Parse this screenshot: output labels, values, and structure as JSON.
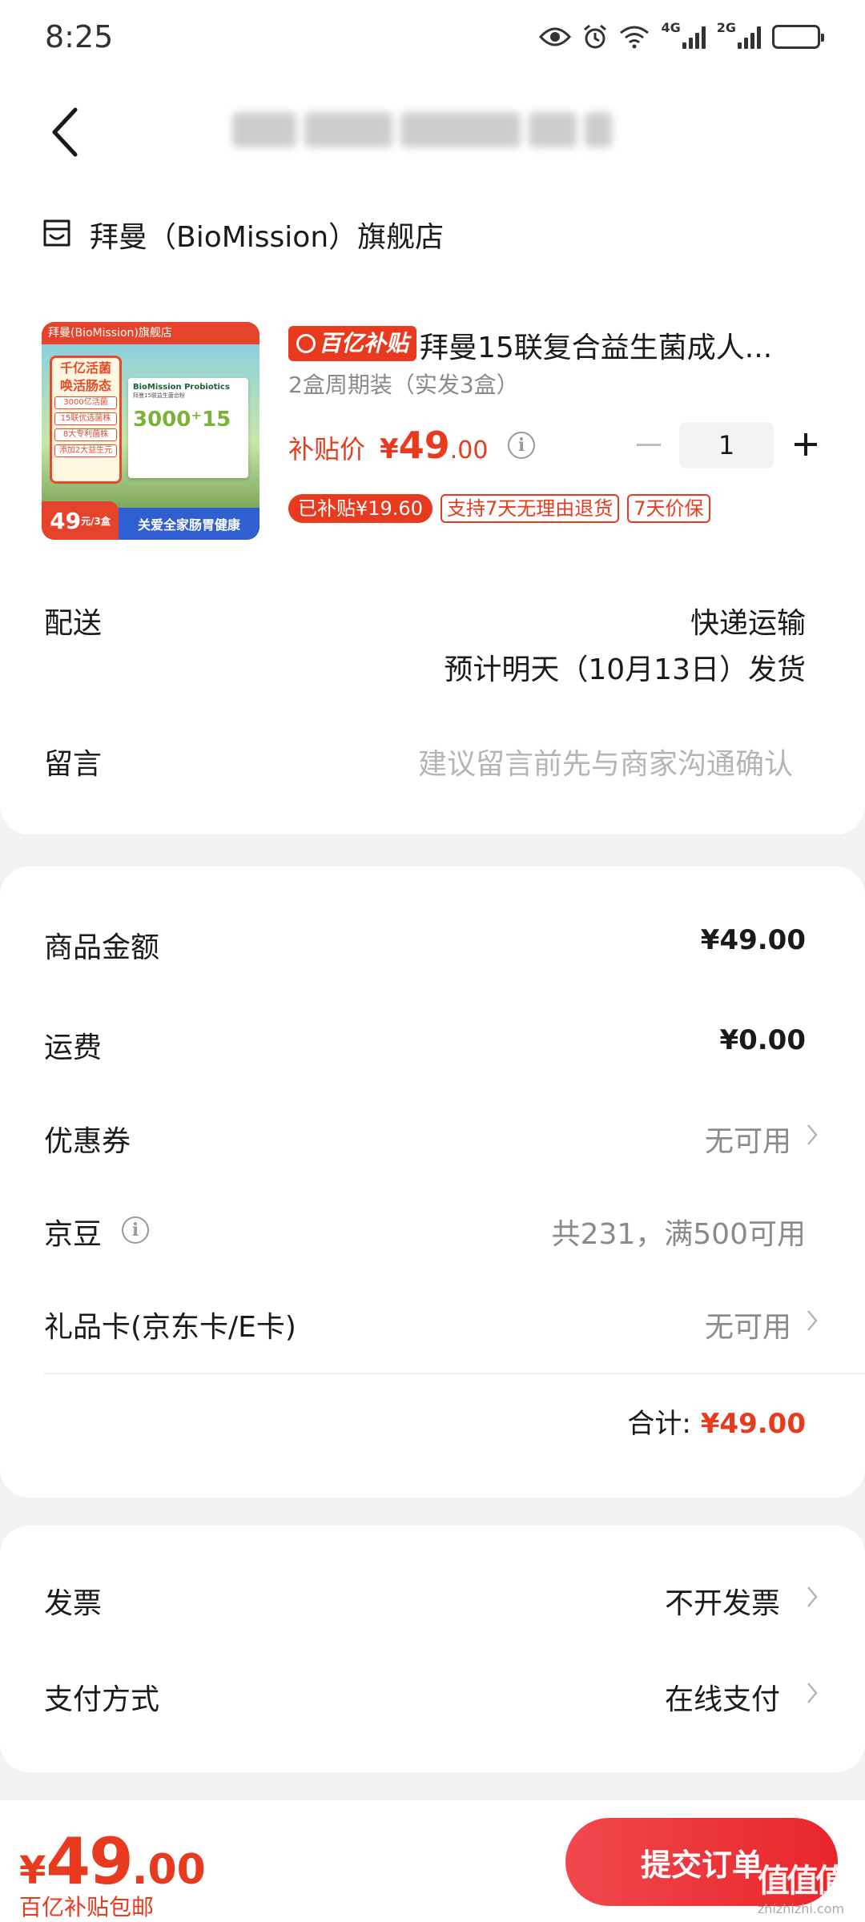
{
  "status_bar": {
    "time": "8:25",
    "network_1": "4G",
    "network_2": "2G"
  },
  "header": {
    "back_icon": "chevron-left-icon"
  },
  "shop": {
    "icon": "store-icon",
    "name": "拜曼（BioMission）旗舰店"
  },
  "product": {
    "image": {
      "top_banner": "拜曼(BioMission)旗舰店",
      "headline_1": "千亿活菌",
      "headline_2": "唤活肠态",
      "labels": [
        "3000亿活菌",
        "15联优选菌株",
        "8大专利菌株",
        "添加2大益生元"
      ],
      "box_brand": "BioMission Probiotics",
      "box_sub": "拜曼15联益生菌合粉",
      "box_number": "3000⁺15",
      "price_int": "49",
      "price_unit": "元/3盒",
      "slogan": "关爱全家肠胃健康"
    },
    "subsidy_badge": "百亿补贴",
    "title": "拜曼15联复合益生菌成人...",
    "spec": "2盒周期装（实发3盒）",
    "price_label": "补贴价",
    "price_currency": "¥",
    "price_int": "49",
    "price_dec": ".00",
    "quantity": "1",
    "tags": [
      "已补贴¥19.60",
      "支持7天无理由退货",
      "7天价保"
    ]
  },
  "delivery": {
    "label": "配送",
    "method": "快递运输",
    "eta": "预计明天（10月13日）发货"
  },
  "message": {
    "label": "留言",
    "placeholder": "建议留言前先与商家沟通确认"
  },
  "summary": {
    "goods_label": "商品金额",
    "goods_value": "¥49.00",
    "shipping_label": "运费",
    "shipping_value": "¥0.00",
    "coupon_label": "优惠券",
    "coupon_value": "无可用",
    "beans_label": "京豆",
    "beans_value": "共231，满500可用",
    "giftcard_label": "礼品卡(京东卡/E卡)",
    "giftcard_value": "无可用",
    "total_label": "合计:",
    "total_value": "¥49.00"
  },
  "extras": {
    "invoice_label": "发票",
    "invoice_value": "不开发票",
    "payment_label": "支付方式",
    "payment_value": "在线支付"
  },
  "footer": {
    "currency": "¥",
    "price_int": "49",
    "price_dec": ".00",
    "note": "百亿补贴包邮",
    "submit_label": "提交订单"
  },
  "watermark": {
    "logo": "值值值",
    "url": "zhizhizhi.com"
  },
  "colors": {
    "accent": "#e83a1e",
    "background": "#f2f2f2",
    "card": "#ffffff",
    "muted": "#8a8a8a"
  }
}
